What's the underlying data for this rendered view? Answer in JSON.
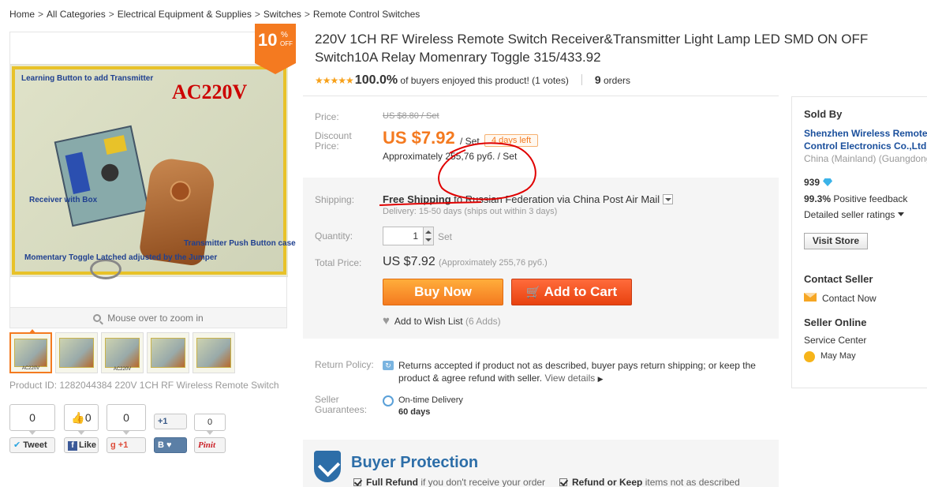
{
  "breadcrumb": [
    {
      "label": "Home"
    },
    {
      "label": "All Categories"
    },
    {
      "label": "Electrical Equipment & Supplies"
    },
    {
      "label": "Switches"
    },
    {
      "label": "Remote Control Switches"
    }
  ],
  "breadcrumb_sep": ">",
  "discount": {
    "value": "10",
    "pct": "%",
    "off": "OFF"
  },
  "photo_text": {
    "learning": "Learning Button to add Transmitter",
    "voltage": "AC220V",
    "receiver": "Receiver with Box",
    "transmitter": "Transmitter Push Button case",
    "momentary": "Momentary Toggle Latched adjusted by the Jumper"
  },
  "zoom_hint": "Mouse over to zoom in",
  "thumbnails": [
    {
      "caption": "AC220V"
    },
    {
      "caption": ""
    },
    {
      "caption": "AC220V"
    },
    {
      "caption": ""
    },
    {
      "caption": ""
    }
  ],
  "product_id_text": "Product ID: 1282044384 220V 1CH RF Wireless Remote Switch",
  "social": {
    "tweet_count": "0",
    "tweet_label": "Tweet",
    "like_count": "0",
    "like_label": "Like",
    "gplus_count": "0",
    "gplus_label": "+1",
    "vk_plus": "+1",
    "vk_b": "B",
    "pin_count": "0",
    "pin_label": "Pinit"
  },
  "title": "220V 1CH RF Wireless Remote Switch Receiver&Transmitter Light Lamp LED SMD ON OFF Switch10A Relay Momenrary Toggle 315/433.92",
  "rating": {
    "stars": "★★★★★",
    "percent": "100.0%",
    "text": "of buyers enjoyed this product! (1 votes)",
    "orders_num": "9",
    "orders_label": "orders"
  },
  "price": {
    "price_label": "Price:",
    "old_price": "US $8.80 / Set",
    "discount_label": "Discount Price:",
    "new_price": "US $7.92",
    "per_set": "/ Set",
    "days_left": "4 days left",
    "approx": "Approximately 255,76 руб. / Set"
  },
  "shipping": {
    "label": "Shipping:",
    "free": "Free Shipping",
    "to": "to",
    "destination": "Russian Federation via China Post Air Mail",
    "delivery": "Delivery: 15-50 days (ships out within 3 days)"
  },
  "quantity": {
    "label": "Quantity:",
    "value": "1",
    "unit": "Set"
  },
  "total": {
    "label": "Total Price:",
    "price": "US $7.92",
    "approx": "(Approximately 255,76 руб.)"
  },
  "buttons": {
    "buy_now": "Buy Now",
    "add_to_cart": "Add to Cart"
  },
  "wishlist": {
    "label": "Add to Wish List",
    "count": "(6 Adds)"
  },
  "return_policy": {
    "label": "Return Policy:",
    "text": "Returns accepted if product not as described, buyer pays return shipping; or keep the product & agree refund with seller.",
    "view_details": "View details"
  },
  "guarantee": {
    "label": "Seller Guarantees:",
    "text": "On-time Delivery",
    "days": "60 days"
  },
  "buyer_protection": {
    "title": "Buyer Protection",
    "item1_bold": "Full Refund",
    "item1_rest": "if you don't receive your order",
    "item2_bold": "Refund or Keep",
    "item2_rest": "items not as described"
  },
  "seller": {
    "sold_by": "Sold By",
    "name": "Shenzhen Wireless Remote Control Electronics Co.,Ltd",
    "country": "China (Mainland) (Guangdong)",
    "score": "939",
    "feedback_pct": "99.3%",
    "feedback_label": "Positive feedback",
    "detailed_ratings": "Detailed seller ratings",
    "visit_store": "Visit Store",
    "contact_head": "Contact Seller",
    "contact_now": "Contact Now",
    "online_head": "Seller Online",
    "service_center": "Service Center",
    "agent": "May May"
  },
  "colors": {
    "accent": "#f47a20",
    "cart": "#e84210",
    "link": "#1a4f9c",
    "protection": "#2d6ea8",
    "annotation": "#e00000"
  }
}
